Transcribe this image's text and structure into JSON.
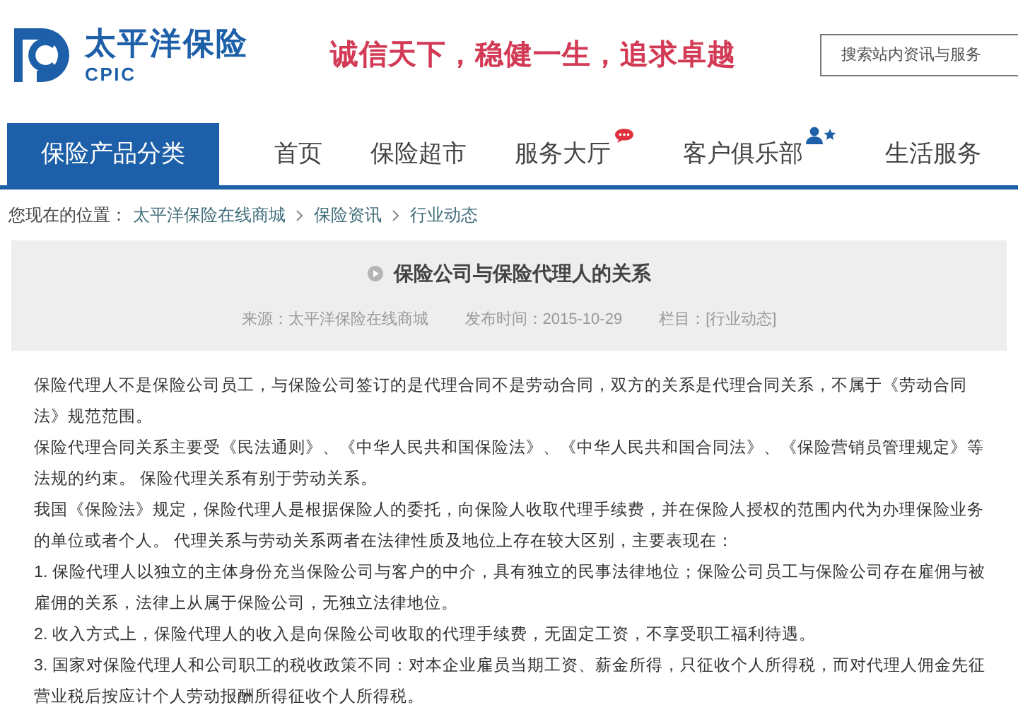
{
  "header": {
    "brand": "太平洋保险",
    "brand_en": "CPIC",
    "slogan": "诚信天下，稳健一生，追求卓越",
    "search": {
      "placeholder": "搜索站内资讯与服务"
    }
  },
  "nav": [
    {
      "label": "保险产品分类",
      "selected": true,
      "kind": "plain"
    },
    {
      "label": "首页",
      "selected": false,
      "kind": "plain"
    },
    {
      "label": "保险超市",
      "selected": false,
      "kind": "plain"
    },
    {
      "label": "服务大厅",
      "selected": false,
      "kind": "message"
    },
    {
      "label": "客户俱乐部",
      "selected": false,
      "kind": "member"
    },
    {
      "label": "生活服务",
      "selected": false,
      "kind": "plain"
    }
  ],
  "breadcrumb": {
    "prefix": "您现在的位置：",
    "items": [
      "太平洋保险在线商城",
      "保险资讯",
      "行业动态"
    ]
  },
  "article": {
    "title": "保险公司与保险代理人的关系",
    "meta": [
      "来源：太平洋保险在线商城",
      "发布时间：2015-10-29",
      "栏目：[行业动态]"
    ],
    "paragraphs": [
      "保险代理人不是保险公司员工，与保险公司签订的是代理合同不是劳动合同，双方的关系是代理合同关系，不属于《劳动合同法》规范范围。",
      "保险代理合同关系主要受《民法通则》、《中华人民共和国保险法》、《中华人民共和国合同法》、《保险营销员管理规定》等法规的约束。 保险代理关系有别于劳动关系。",
      "我国《保险法》规定，保险代理人是根据保险人的委托，向保险人收取代理手续费，并在保险人授权的范围内代为办理保险业务的单位或者个人。 代理关系与劳动关系两者在法律性质及地位上存在较大区别，主要表现在：",
      "1. 保险代理人以独立的主体身份充当保险公司与客户的中介，具有独立的民事法律地位；保险公司员工与保险公司存在雇佣与被雇佣的关系，法律上从属于保险公司，无独立法律地位。",
      "2. 收入方式上，保险代理人的收入是向保险公司收取的代理手续费，无固定工资，不享受职工福利待遇。",
      "3. 国家对保险代理人和公司职工的税收政策不同：对本企业雇员当期工资、薪金所得，只征收个人所得税，而对代理人佣金先征营业税后按应计个人劳动报酬所得征收个人所得税。"
    ]
  }
}
